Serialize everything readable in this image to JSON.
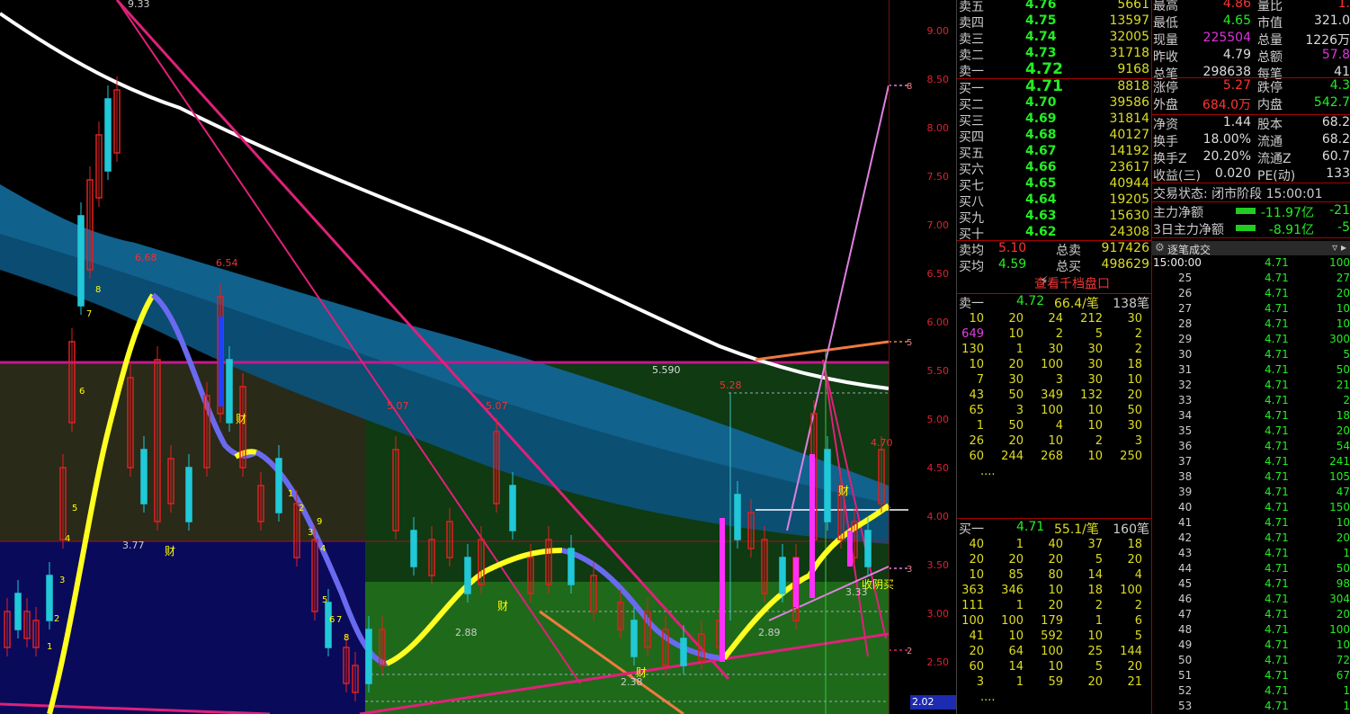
{
  "chart": {
    "price_axis": [
      "9.00",
      "8.50",
      "8.00",
      "7.50",
      "7.00",
      "6.50",
      "6.00",
      "5.50",
      "5.00",
      "4.50",
      "4.00",
      "3.50",
      "3.00",
      "2.50"
    ],
    "current_price_box": "2.02",
    "labels": {
      "high": "9.33",
      "p654": "6.54",
      "p668": "6.68",
      "low377": "3.77",
      "p507a": "5.07",
      "p507b": "5.07",
      "p559": "5.590",
      "p528": "5.28",
      "p288": "2.88",
      "p238": "2.38",
      "p289": "2.89",
      "p470": "4.70",
      "p333": "3.33",
      "sig_cai": "财",
      "sig_shouyinmai": "收阴买",
      "right8": "8",
      "right5": "5",
      "right3": "3",
      "right2": "2"
    },
    "counts": [
      "1",
      "2",
      "3",
      "4",
      "5",
      "6",
      "7",
      "8",
      "9",
      "1",
      "2",
      "3",
      "4",
      "5",
      "6",
      "7",
      "8",
      "9"
    ]
  },
  "orderbook": {
    "sells": [
      {
        "label": "卖五",
        "price": "4.76",
        "vol": "5661"
      },
      {
        "label": "卖四",
        "price": "4.75",
        "vol": "13597"
      },
      {
        "label": "卖三",
        "price": "4.74",
        "vol": "32005"
      },
      {
        "label": "卖二",
        "price": "4.73",
        "vol": "31718"
      },
      {
        "label": "卖一",
        "price": "4.72",
        "vol": "9168"
      }
    ],
    "buys": [
      {
        "label": "买一",
        "price": "4.71",
        "vol": "8818"
      },
      {
        "label": "买二",
        "price": "4.70",
        "vol": "39586"
      },
      {
        "label": "买三",
        "price": "4.69",
        "vol": "31814"
      },
      {
        "label": "买四",
        "price": "4.68",
        "vol": "40127"
      },
      {
        "label": "买五",
        "price": "4.67",
        "vol": "14192"
      },
      {
        "label": "买六",
        "price": "4.66",
        "vol": "23617"
      },
      {
        "label": "买七",
        "price": "4.65",
        "vol": "40944"
      },
      {
        "label": "买八",
        "price": "4.64",
        "vol": "19205"
      },
      {
        "label": "买九",
        "price": "4.63",
        "vol": "15630"
      },
      {
        "label": "买十",
        "price": "4.62",
        "vol": "24308"
      }
    ],
    "avg": [
      {
        "label": "卖均",
        "price": "5.10",
        "tlabel": "总卖",
        "total": "917426"
      },
      {
        "label": "买均",
        "price": "4.59",
        "tlabel": "总买",
        "total": "498629"
      }
    ],
    "view10_label": "查看千档盘口",
    "sell1_summary": {
      "label": "卖一",
      "price": "4.72",
      "per": "66.4/笔",
      "count": "138笔"
    },
    "sell1_queue": [
      [
        "10",
        "20",
        "24",
        "212",
        "30"
      ],
      [
        "649",
        "10",
        "2",
        "5",
        "2"
      ],
      [
        "130",
        "1",
        "30",
        "30",
        "2"
      ],
      [
        "10",
        "20",
        "100",
        "30",
        "18"
      ],
      [
        "7",
        "30",
        "3",
        "30",
        "10"
      ],
      [
        "43",
        "50",
        "349",
        "132",
        "20"
      ],
      [
        "65",
        "3",
        "100",
        "10",
        "50"
      ],
      [
        "1",
        "50",
        "4",
        "10",
        "30"
      ],
      [
        "26",
        "20",
        "10",
        "2",
        "3"
      ],
      [
        "60",
        "244",
        "268",
        "10",
        "250"
      ],
      [
        "....",
        "",
        "",
        "",
        ""
      ]
    ],
    "buy1_summary": {
      "label": "买一",
      "price": "4.71",
      "per": "55.1/笔",
      "count": "160笔"
    },
    "buy1_queue": [
      [
        "40",
        "1",
        "40",
        "37",
        "18"
      ],
      [
        "20",
        "20",
        "20",
        "5",
        "20"
      ],
      [
        "10",
        "85",
        "80",
        "14",
        "4"
      ],
      [
        "363",
        "346",
        "10",
        "18",
        "100"
      ],
      [
        "111",
        "1",
        "20",
        "2",
        "2"
      ],
      [
        "100",
        "100",
        "179",
        "1",
        "6"
      ],
      [
        "41",
        "10",
        "592",
        "10",
        "5"
      ],
      [
        "20",
        "64",
        "100",
        "25",
        "144"
      ],
      [
        "60",
        "14",
        "10",
        "5",
        "20"
      ],
      [
        "3",
        "1",
        "59",
        "20",
        "21"
      ],
      [
        "....",
        "",
        "",
        "",
        ""
      ]
    ]
  },
  "info": {
    "rows": [
      {
        "l1": "最高",
        "v1": "4.86",
        "l2": "量比",
        "v2": "1."
      },
      {
        "l1": "最低",
        "v1": "4.65",
        "l2": "市值",
        "v2": "321.0"
      },
      {
        "l1": "现量",
        "v1": "225504",
        "l2": "总量",
        "v2": "1226万"
      },
      {
        "l1": "昨收",
        "v1": "4.79",
        "l2": "总额",
        "v2": "57.8"
      },
      {
        "l1": "总笔",
        "v1": "298638",
        "l2": "每笔",
        "v2": "41"
      },
      {
        "l1": "涨停",
        "v1": "5.27",
        "l2": "跌停",
        "v2": "4.3"
      },
      {
        "l1": "外盘",
        "v1": "684.0万",
        "l2": "内盘",
        "v2": "542.7"
      },
      {
        "l1": "净资",
        "v1": "1.44",
        "l2": "股本",
        "v2": "68.2"
      },
      {
        "l1": "换手",
        "v1": "18.00%",
        "l2": "流通",
        "v2": "68.2"
      },
      {
        "l1": "换手Z",
        "v1": "20.20%",
        "l2": "流通Z",
        "v2": "60.7"
      },
      {
        "l1": "收益(三)",
        "v1": "0.020",
        "l2": "PE(动)",
        "v2": "133"
      }
    ],
    "trade_status": "交易状态: 闭市阶段 15:00:01",
    "main_net": {
      "label": "主力净额",
      "value": "-11.97亿",
      "extra": "-21"
    },
    "main_net3": {
      "label": "3日主力净额",
      "value": "-8.91亿",
      "extra": "-5"
    },
    "ticks_header": "逐笔成交",
    "ticks": [
      {
        "t": "15:00:00",
        "p": "4.71",
        "v": "100"
      },
      {
        "t": "25",
        "p": "4.71",
        "v": "27"
      },
      {
        "t": "26",
        "p": "4.71",
        "v": "20"
      },
      {
        "t": "27",
        "p": "4.71",
        "v": "10"
      },
      {
        "t": "28",
        "p": "4.71",
        "v": "10"
      },
      {
        "t": "29",
        "p": "4.71",
        "v": "300"
      },
      {
        "t": "30",
        "p": "4.71",
        "v": "5"
      },
      {
        "t": "31",
        "p": "4.71",
        "v": "50"
      },
      {
        "t": "32",
        "p": "4.71",
        "v": "21"
      },
      {
        "t": "33",
        "p": "4.71",
        "v": "2"
      },
      {
        "t": "34",
        "p": "4.71",
        "v": "18"
      },
      {
        "t": "35",
        "p": "4.71",
        "v": "20"
      },
      {
        "t": "36",
        "p": "4.71",
        "v": "54"
      },
      {
        "t": "37",
        "p": "4.71",
        "v": "241"
      },
      {
        "t": "38",
        "p": "4.71",
        "v": "105"
      },
      {
        "t": "39",
        "p": "4.71",
        "v": "47"
      },
      {
        "t": "40",
        "p": "4.71",
        "v": "150"
      },
      {
        "t": "41",
        "p": "4.71",
        "v": "10"
      },
      {
        "t": "42",
        "p": "4.71",
        "v": "20"
      },
      {
        "t": "43",
        "p": "4.71",
        "v": "1"
      },
      {
        "t": "44",
        "p": "4.71",
        "v": "50"
      },
      {
        "t": "45",
        "p": "4.71",
        "v": "98"
      },
      {
        "t": "46",
        "p": "4.71",
        "v": "304"
      },
      {
        "t": "47",
        "p": "4.71",
        "v": "20"
      },
      {
        "t": "48",
        "p": "4.71",
        "v": "100"
      },
      {
        "t": "49",
        "p": "4.71",
        "v": "10"
      },
      {
        "t": "50",
        "p": "4.71",
        "v": "72"
      },
      {
        "t": "51",
        "p": "4.71",
        "v": "67"
      },
      {
        "t": "52",
        "p": "4.71",
        "v": "1"
      },
      {
        "t": "53",
        "p": "4.71",
        "v": "1"
      }
    ]
  }
}
